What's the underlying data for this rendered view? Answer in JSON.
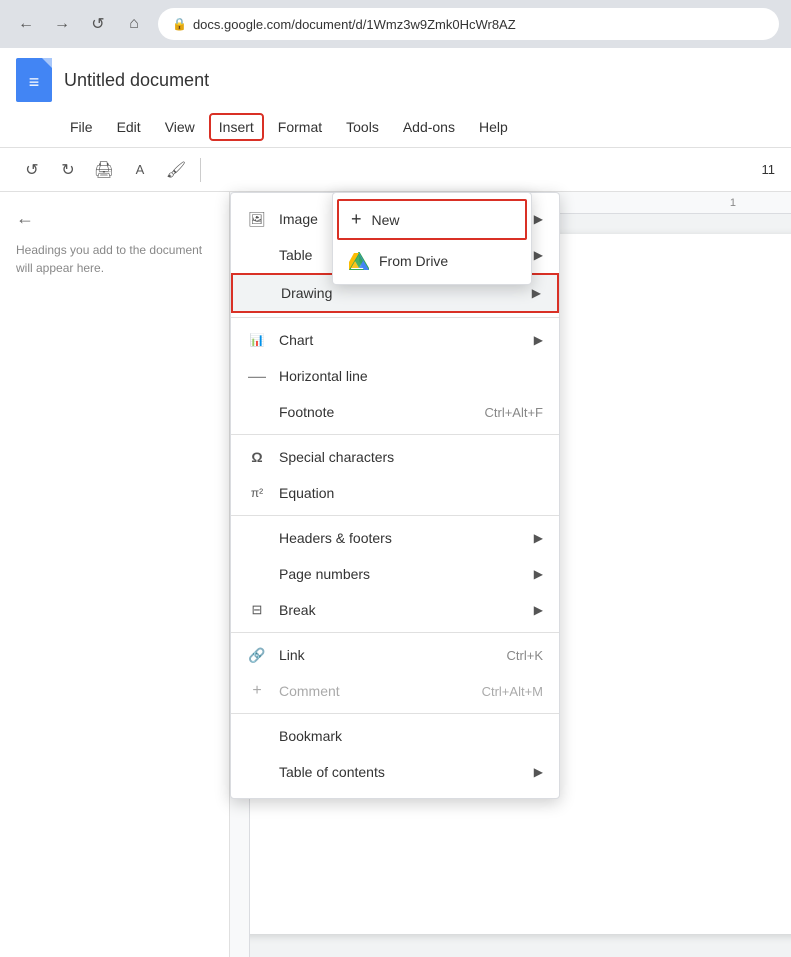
{
  "browser": {
    "back_icon": "←",
    "forward_icon": "→",
    "reload_icon": "↺",
    "home_icon": "⌂",
    "url": "docs.google.com/document/d/1Wmz3w9Zmk0HcWr8AZ",
    "lock_icon": "🔒"
  },
  "app": {
    "logo_letter": "≡",
    "title": "Untitled document",
    "menu_items": [
      "File",
      "Edit",
      "View",
      "Insert",
      "Format",
      "Tools",
      "Add-ons",
      "Help"
    ],
    "insert_label": "Insert",
    "format_label": "Format"
  },
  "toolbar": {
    "undo_icon": "↺",
    "redo_icon": "↻",
    "print_icon": "🖨",
    "paintformat_icon": "A",
    "format_icon": "🖌",
    "font_size": "11"
  },
  "sidebar": {
    "back_icon": "←",
    "hint": "Headings you add to the document will appear here."
  },
  "insert_menu": {
    "items": [
      {
        "id": "image",
        "icon": "🖼",
        "label": "Image",
        "has_arrow": true,
        "shortcut": ""
      },
      {
        "id": "table",
        "icon": "",
        "label": "Table",
        "has_arrow": true,
        "shortcut": ""
      },
      {
        "id": "drawing",
        "icon": "",
        "label": "Drawing",
        "has_arrow": true,
        "shortcut": "",
        "highlighted": true
      },
      {
        "id": "chart",
        "icon": "📊",
        "label": "Chart",
        "has_arrow": true,
        "shortcut": ""
      },
      {
        "id": "horizontal-line",
        "icon": "—",
        "label": "Horizontal line",
        "has_arrow": false,
        "shortcut": ""
      },
      {
        "id": "footnote",
        "icon": "",
        "label": "Footnote",
        "has_arrow": false,
        "shortcut": "Ctrl+Alt+F"
      },
      {
        "id": "special-characters",
        "icon": "Ω",
        "label": "Special characters",
        "has_arrow": false,
        "shortcut": ""
      },
      {
        "id": "equation",
        "icon": "π²",
        "label": "Equation",
        "has_arrow": false,
        "shortcut": ""
      },
      {
        "id": "headers-footers",
        "icon": "",
        "label": "Headers & footers",
        "has_arrow": true,
        "shortcut": ""
      },
      {
        "id": "page-numbers",
        "icon": "",
        "label": "Page numbers",
        "has_arrow": true,
        "shortcut": ""
      },
      {
        "id": "break",
        "icon": "⊟",
        "label": "Break",
        "has_arrow": true,
        "shortcut": ""
      },
      {
        "id": "link",
        "icon": "🔗",
        "label": "Link",
        "has_arrow": false,
        "shortcut": "Ctrl+K"
      },
      {
        "id": "comment",
        "icon": "+",
        "label": "Comment",
        "has_arrow": false,
        "shortcut": "Ctrl+Alt+M",
        "disabled": true
      },
      {
        "id": "bookmark",
        "icon": "",
        "label": "Bookmark",
        "has_arrow": false,
        "shortcut": ""
      },
      {
        "id": "toc",
        "icon": "",
        "label": "Table of contents",
        "has_arrow": true,
        "shortcut": ""
      }
    ]
  },
  "drawing_submenu": {
    "new_label": "New",
    "from_drive_label": "From Drive"
  }
}
